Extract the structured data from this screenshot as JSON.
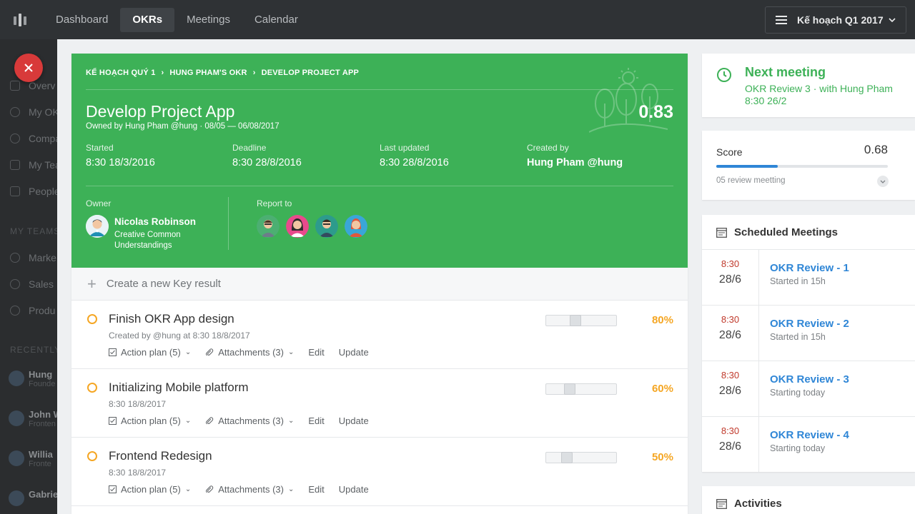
{
  "nav": {
    "items": [
      {
        "label": "Dashboard",
        "active": false
      },
      {
        "label": "OKRs",
        "active": true
      },
      {
        "label": "Meetings",
        "active": false
      },
      {
        "label": "Calendar",
        "active": false
      }
    ],
    "plan_select": "Kế hoạch Q1 2017"
  },
  "sidebar": {
    "items": [
      "Overv",
      "My OK",
      "Compa",
      "My Tea",
      "People"
    ],
    "section_teams": "MY TEAMS",
    "teams": [
      "Marke",
      "Sales",
      "Produ"
    ],
    "section_recent": "RECENTLY U",
    "users": [
      {
        "name": "Hung",
        "sub": "Founde"
      },
      {
        "name": "John W",
        "sub": "Fronten"
      },
      {
        "name": "Willia",
        "sub": "Fronte"
      },
      {
        "name": "Gabrie",
        "sub": ""
      }
    ]
  },
  "okr": {
    "breadcrumbs": [
      "KẾ HOẠCH QUÝ 1",
      "HUNG PHAM'S OKR",
      "DEVELOP PROJECT APP"
    ],
    "title": "Develop Project App",
    "owned": "Owned by Hung Pham @hung · 08/05 — 06/08/2017",
    "score": "0.83",
    "meta": [
      {
        "label": "Started",
        "value": "8:30 18/3/2016"
      },
      {
        "label": "Deadline",
        "value": "8:30 28/8/2016"
      },
      {
        "label": "Last updated",
        "value": "8:30 28/8/2016"
      },
      {
        "label": "Created by",
        "value": "Hung Pham @hung"
      }
    ],
    "owner_label": "Owner",
    "owner_name": "Nicolas Robinson",
    "owner_desc": "Creative Common Understandings",
    "report_label": "Report to",
    "new_kr": "Create a new Key result",
    "key_results": [
      {
        "title": "Finish OKR App design",
        "created": "Created by @hung at 8:30 18/8/2017",
        "action_plan": "Action plan (5)",
        "attachments": "Attachments (3)",
        "edit": "Edit",
        "update": "Update",
        "percent_label": "80%",
        "progress": 0.8
      },
      {
        "title": "Initializing Mobile platform",
        "created": "8:30 18/8/2017",
        "action_plan": "Action plan (5)",
        "attachments": "Attachments (3)",
        "edit": "Edit",
        "update": "Update",
        "percent_label": "60%",
        "progress": 0.6
      },
      {
        "title": "Frontend Redesign",
        "created": "8:30 18/8/2017",
        "action_plan": "Action plan (5)",
        "attachments": "Attachments (3)",
        "edit": "Edit",
        "update": "Update",
        "percent_label": "50%",
        "progress": 0.5
      }
    ]
  },
  "next_meeting": {
    "title": "Next meeting",
    "line1": "OKR Review 3 · with Hung Pham",
    "line2": "8:30 26/2"
  },
  "score_card": {
    "label": "Score",
    "value": "0.68",
    "progress": 0.36,
    "reviews": "05 review meetting"
  },
  "scheduled": {
    "title": "Scheduled Meetings",
    "meetings": [
      {
        "time": "8:30",
        "date": "28/6",
        "name": "OKR Review - 1",
        "status": "Started in 15h"
      },
      {
        "time": "8:30",
        "date": "28/6",
        "name": "OKR Review - 2",
        "status": "Started in 15h"
      },
      {
        "time": "8:30",
        "date": "28/6",
        "name": "OKR Review - 3",
        "status": "Starting today"
      },
      {
        "time": "8:30",
        "date": "28/6",
        "name": "OKR Review - 4",
        "status": "Starting today"
      }
    ]
  },
  "activities": {
    "title": "Activities"
  },
  "colors": {
    "green": "#3db157",
    "orange": "#f5a623",
    "blue": "#2f86d6",
    "red": "#d83a3a"
  }
}
